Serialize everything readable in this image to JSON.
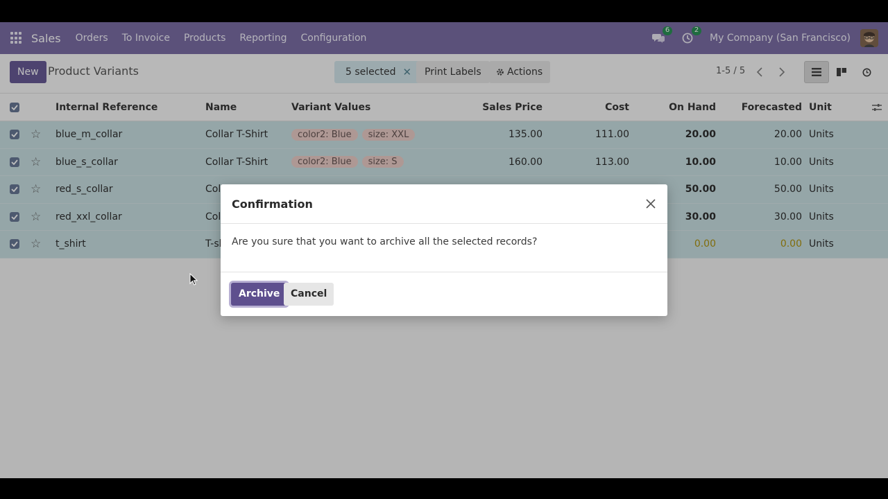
{
  "navbar": {
    "app_name": "Sales",
    "menu": [
      "Orders",
      "To Invoice",
      "Products",
      "Reporting",
      "Configuration"
    ],
    "messages_count": "6",
    "activities_count": "2",
    "company": "My Company (San Francisco)",
    "bg_color": "#71639e"
  },
  "control_panel": {
    "new_label": "New",
    "title": "Product Variants",
    "selected_label": "5 selected",
    "print_labels": "Print Labels",
    "actions_label": "Actions",
    "pager": "1-5 / 5"
  },
  "table": {
    "headers": [
      "Internal Reference",
      "Name",
      "Variant Values",
      "Sales Price",
      "Cost",
      "On Hand",
      "Forecasted",
      "Unit"
    ],
    "rows": [
      {
        "ref": "blue_m_collar",
        "name": "Collar T-Shirt",
        "tags": [
          "color2: Blue",
          "size: XXL"
        ],
        "price": "135.00",
        "cost": "111.00",
        "on_hand": "20.00",
        "forecast": "20.00",
        "unit": "Units"
      },
      {
        "ref": "blue_s_collar",
        "name": "Collar T-Shirt",
        "tags": [
          "color2: Blue",
          "size: S"
        ],
        "price": "160.00",
        "cost": "113.00",
        "on_hand": "10.00",
        "forecast": "10.00",
        "unit": "Units"
      },
      {
        "ref": "red_s_collar",
        "name": "Col",
        "tags": [],
        "price": "",
        "cost": "",
        "on_hand": "50.00",
        "forecast": "50.00",
        "unit": "Units"
      },
      {
        "ref": "red_xxl_collar",
        "name": "Col",
        "tags": [],
        "price": "",
        "cost": "",
        "on_hand": "30.00",
        "forecast": "30.00",
        "unit": "Units"
      },
      {
        "ref": "t_shirt",
        "name": "T-sh",
        "tags": [],
        "price": "",
        "cost": "",
        "on_hand": "0.00",
        "forecast": "0.00",
        "unit": "Units"
      }
    ],
    "selected_row_color": "#c5dde0"
  },
  "modal": {
    "title": "Confirmation",
    "message": "Are you sure that you want to archive all the selected records?",
    "confirm_label": "Archive",
    "cancel_label": "Cancel"
  }
}
